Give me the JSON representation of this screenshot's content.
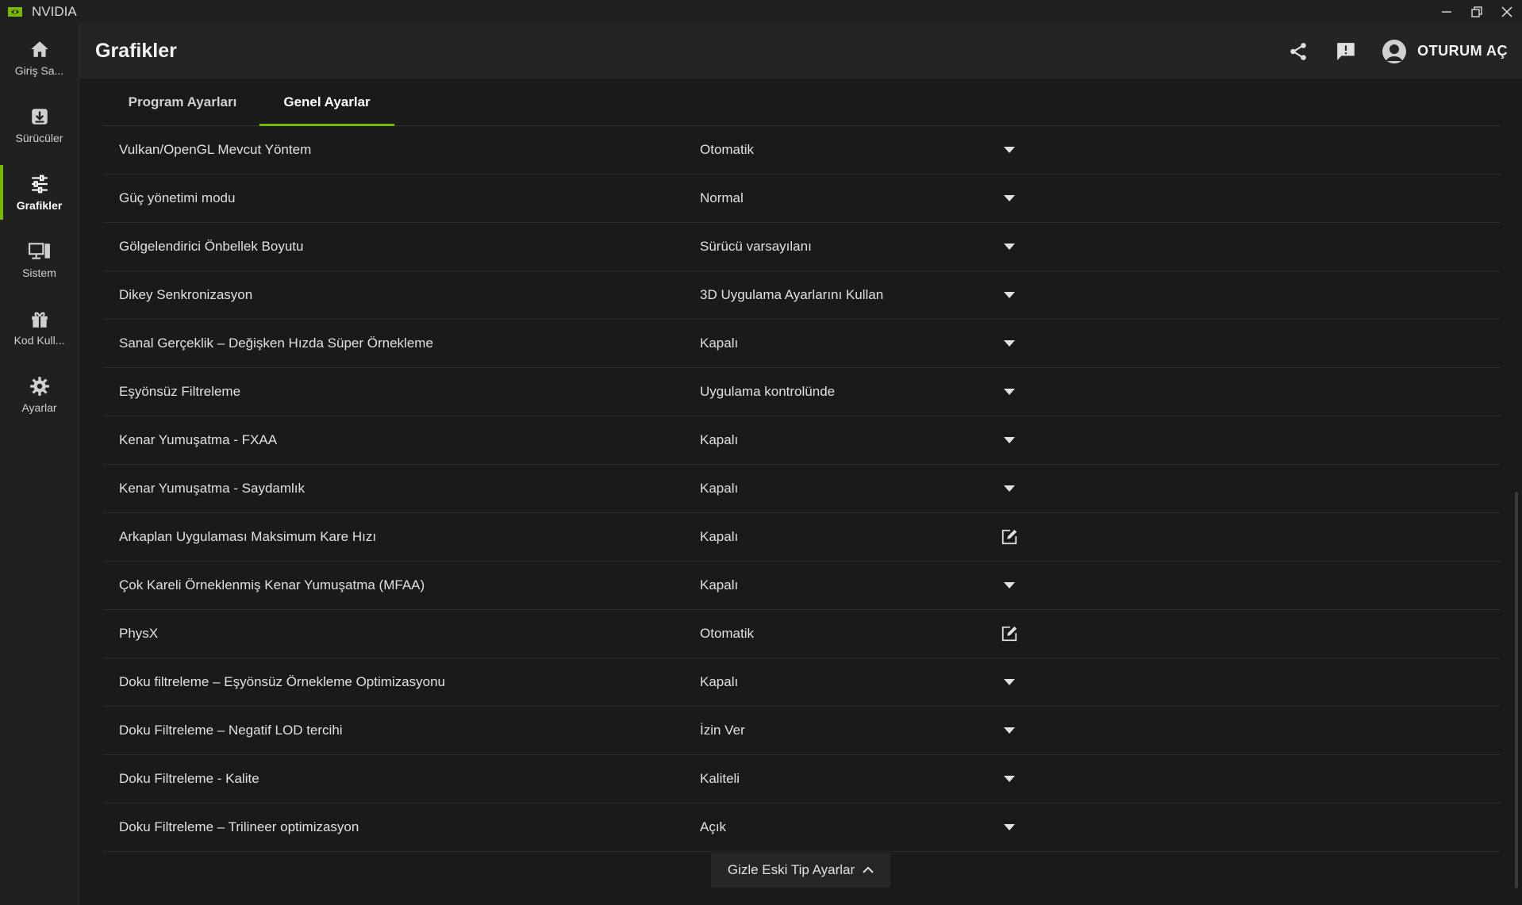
{
  "app": {
    "name": "NVIDIA",
    "accent": "#76b900"
  },
  "window_controls": [
    {
      "name": "minimize-button",
      "icon": "minimize-icon"
    },
    {
      "name": "restore-button",
      "icon": "restore-icon"
    },
    {
      "name": "close-button",
      "icon": "close-icon"
    }
  ],
  "sidebar": {
    "items": [
      {
        "label": "Giriş Sa...",
        "icon": "home-icon",
        "active": false
      },
      {
        "label": "Sürücüler",
        "icon": "driver-download-icon",
        "active": false
      },
      {
        "label": "Grafikler",
        "icon": "sliders-icon",
        "active": true
      },
      {
        "label": "Sistem",
        "icon": "monitor-icon",
        "active": false
      },
      {
        "label": "Kod Kull...",
        "icon": "gift-icon",
        "active": false
      },
      {
        "label": "Ayarlar",
        "icon": "gear-icon",
        "active": false
      }
    ]
  },
  "header": {
    "title": "Grafikler",
    "share_icon": "share-icon",
    "feedback_icon": "feedback-icon",
    "signin_label": "OTURUM AÇ"
  },
  "tabs": [
    {
      "label": "Program Ayarları",
      "active": false
    },
    {
      "label": "Genel Ayarlar",
      "active": true
    }
  ],
  "settings": [
    {
      "label": "Vulkan/OpenGL Mevcut Yöntem",
      "value": "Otomatik",
      "control": "dropdown"
    },
    {
      "label": "Güç yönetimi modu",
      "value": "Normal",
      "control": "dropdown"
    },
    {
      "label": "Gölgelendirici Önbellek Boyutu",
      "value": "Sürücü varsayılanı",
      "control": "dropdown"
    },
    {
      "label": "Dikey Senkronizasyon",
      "value": "3D Uygulama Ayarlarını Kullan",
      "control": "dropdown"
    },
    {
      "label": "Sanal Gerçeklik – Değişken Hızda Süper Örnekleme",
      "value": "Kapalı",
      "control": "dropdown"
    },
    {
      "label": "Eşyönsüz Filtreleme",
      "value": "Uygulama kontrolünde",
      "control": "dropdown"
    },
    {
      "label": "Kenar Yumuşatma - FXAA",
      "value": "Kapalı",
      "control": "dropdown"
    },
    {
      "label": "Kenar Yumuşatma - Saydamlık",
      "value": "Kapalı",
      "control": "dropdown"
    },
    {
      "label": "Arkaplan Uygulaması Maksimum Kare Hızı",
      "value": "Kapalı",
      "control": "edit"
    },
    {
      "label": "Çok Kareli Örneklenmiş Kenar Yumuşatma (MFAA)",
      "value": "Kapalı",
      "control": "dropdown"
    },
    {
      "label": "PhysX",
      "value": "Otomatik",
      "control": "edit"
    },
    {
      "label": "Doku filtreleme – Eşyönsüz Örnekleme Optimizasyonu",
      "value": "Kapalı",
      "control": "dropdown"
    },
    {
      "label": "Doku Filtreleme – Negatif LOD tercihi",
      "value": "İzin Ver",
      "control": "dropdown"
    },
    {
      "label": "Doku Filtreleme - Kalite",
      "value": "Kaliteli",
      "control": "dropdown"
    },
    {
      "label": "Doku Filtreleme – Trilineer optimizasyon",
      "value": "Açık",
      "control": "dropdown"
    }
  ],
  "footer": {
    "collapse_label": "Gizle Eski Tip Ayarlar"
  }
}
